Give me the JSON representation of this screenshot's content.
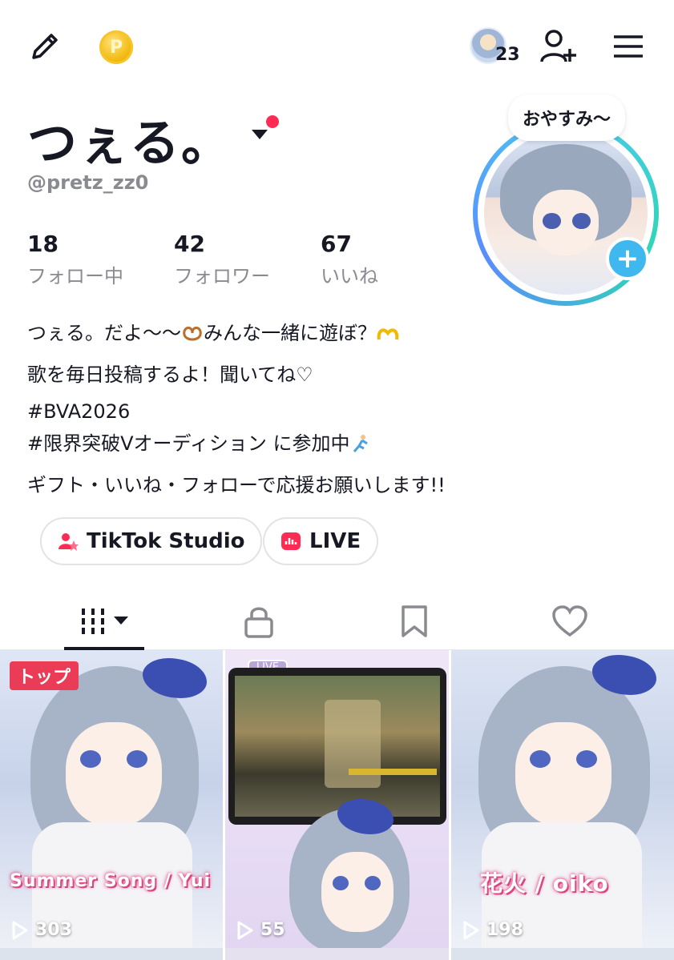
{
  "profile": {
    "display_name": "つぇる。",
    "handle": "@pretz_zz0",
    "status_note": "おやすみ〜",
    "friends_count": "23"
  },
  "stats": [
    {
      "value": "18",
      "label": "フォロー中"
    },
    {
      "value": "42",
      "label": "フォロワー"
    },
    {
      "value": "67",
      "label": "いいね"
    }
  ],
  "bio": {
    "line1": "つぇる。だよ〜〜",
    "line1b": "みんな一緒に遊ぼ？",
    "line2": "歌を毎日投稿するよ！聞いてね♡",
    "line3": "#BVA2026",
    "line4": "#限界突破Vオーディション に参加中",
    "line5": "ギフト・いいね・フォローで応援お願いします!!"
  },
  "buttons": {
    "studio": "TikTok Studio",
    "live": "LIVE"
  },
  "colors": {
    "accent_red": "#fe2c55",
    "plus_blue": "#3fb8f0",
    "coin_gold": "#f0b400"
  },
  "videos": [
    {
      "badge": "トップ",
      "caption": "Summer Song / Yui",
      "views": "303"
    },
    {
      "badge": "",
      "caption": "",
      "views": "55",
      "overlay_label": "LIVE"
    },
    {
      "badge": "",
      "caption": "花火 / oiko",
      "views": "198"
    }
  ]
}
